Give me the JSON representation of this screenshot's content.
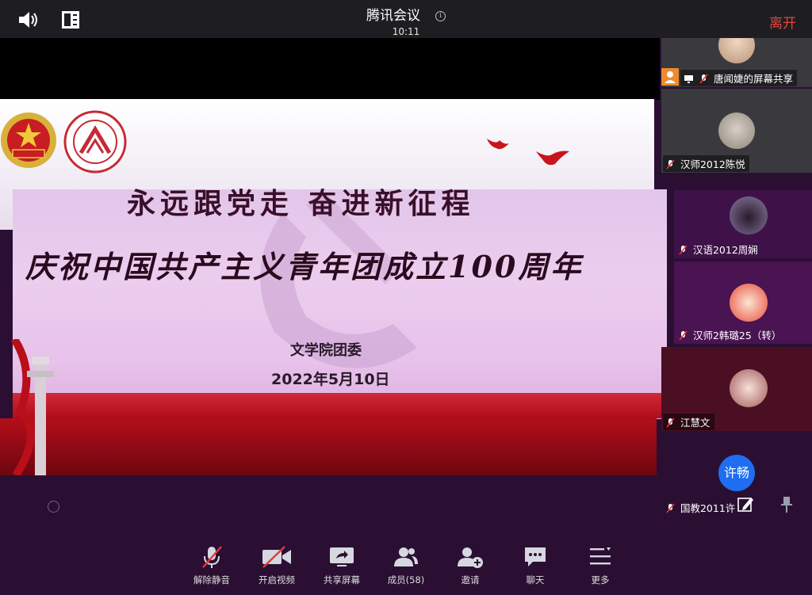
{
  "header": {
    "app_title": "腾讯会议",
    "time": "10:11",
    "leave_label": "离开"
  },
  "slide": {
    "slogan_top": "永远跟党走 奋进新征程",
    "slogan_main": "庆祝中国共产主义青年团成立100周年",
    "organizer": "文学院团委",
    "date": "2022年5月10日"
  },
  "participants": [
    {
      "name": "唐闻婕的屏幕共享",
      "screen_sharing": true
    },
    {
      "name": "汉师2012陈悦"
    },
    {
      "name": "汉语2012周娴"
    },
    {
      "name": "汉师2韩璐25（转）"
    },
    {
      "name": "江慧文"
    },
    {
      "name": "国教2011许",
      "avatar_text": "许畅"
    }
  ],
  "toolbar": {
    "items": [
      {
        "label": "解除静音",
        "icon": "mic-muted-icon"
      },
      {
        "label": "开启视频",
        "icon": "camera-off-icon"
      },
      {
        "label": "共享屏幕",
        "icon": "share-screen-icon"
      },
      {
        "label": "成员(58)",
        "icon": "members-icon"
      },
      {
        "label": "邀请",
        "icon": "invite-icon"
      },
      {
        "label": "聊天",
        "icon": "chat-icon"
      },
      {
        "label": "更多",
        "icon": "more-icon"
      }
    ]
  },
  "colors": {
    "leave": "#e2463c",
    "share_tag": "#f08a2c",
    "avatar_blue": "#1f6df0",
    "mute_red": "#e03a3a"
  }
}
